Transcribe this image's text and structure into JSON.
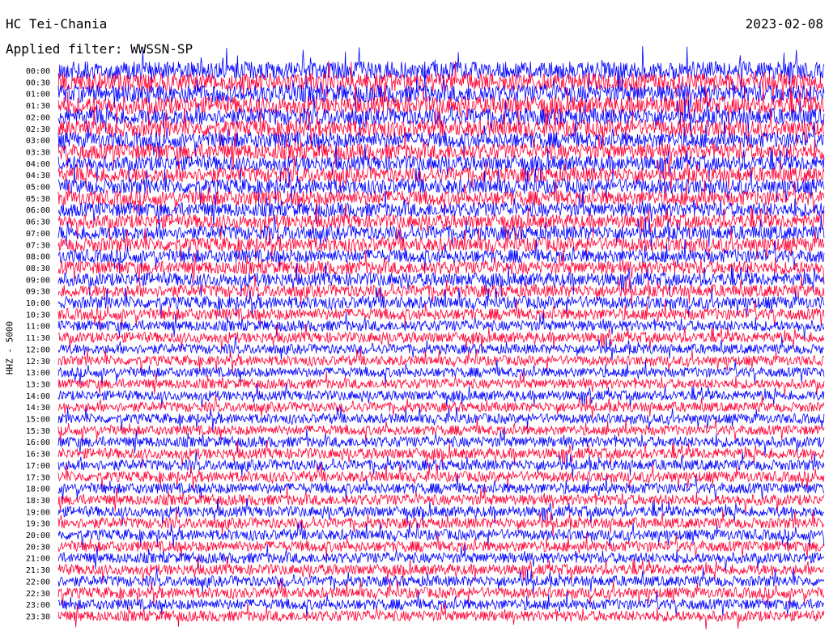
{
  "header": {
    "station": "HC Tei-Chania",
    "date": "2023-02-08",
    "filter": "Applied filter: WWSSN-SP",
    "channel": "HHZ - 5000"
  },
  "chart_data": {
    "type": "line",
    "title": "HC Tei-Chania",
    "subtitle": "Applied filter: WWSSN-SP",
    "ylabel": "HHZ - 5000",
    "row_labels": [
      "00:00",
      "00:30",
      "01:00",
      "01:30",
      "02:00",
      "02:30",
      "03:00",
      "03:30",
      "04:00",
      "04:30",
      "05:00",
      "05:30",
      "06:00",
      "06:30",
      "07:00",
      "07:30",
      "08:00",
      "08:30",
      "09:00",
      "09:30",
      "10:00",
      "10:30",
      "11:00",
      "11:30",
      "12:00",
      "12:30",
      "13:00",
      "13:30",
      "14:00",
      "14:30",
      "15:00",
      "15:30",
      "16:00",
      "16:30",
      "17:00",
      "17:30",
      "18:00",
      "18:30",
      "19:00",
      "19:30",
      "20:00",
      "20:30",
      "21:00",
      "21:30",
      "22:00",
      "22:30",
      "23:00",
      "23:30"
    ],
    "trace_colors": [
      "#0000ff",
      "#ff0033"
    ],
    "relative_amplitude_per_row": [
      1.0,
      1.0,
      1.0,
      1.0,
      0.95,
      0.95,
      0.9,
      0.9,
      0.85,
      0.85,
      0.85,
      0.85,
      0.8,
      0.8,
      0.8,
      0.8,
      0.75,
      0.75,
      0.75,
      0.7,
      0.7,
      0.65,
      0.6,
      0.6,
      0.55,
      0.55,
      0.55,
      0.55,
      0.55,
      0.55,
      0.55,
      0.55,
      0.6,
      0.6,
      0.6,
      0.6,
      0.6,
      0.6,
      0.6,
      0.6,
      0.6,
      0.6,
      0.6,
      0.6,
      0.6,
      0.6,
      0.6,
      0.6
    ],
    "grid": false
  }
}
